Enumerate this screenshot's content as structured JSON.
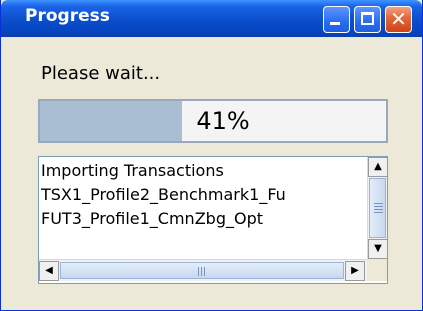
{
  "window": {
    "title": "Progress"
  },
  "title_buttons": {
    "minimize_icon": "minimize-icon",
    "maximize_icon": "maximize-icon",
    "close_icon": "close-icon",
    "close_glyph": "✕"
  },
  "status": {
    "label": "Please wait..."
  },
  "progress": {
    "percent_text": "41%",
    "value": 0.41
  },
  "log": {
    "items": [
      "Importing Transactions",
      "TSX1_Profile2_Benchmark1_Fu",
      "FUT3_Profile1_CmnZbg_Opt"
    ]
  },
  "scrollbars": {
    "up_arrow": "▲",
    "down_arrow": "▼",
    "left_arrow": "◀",
    "right_arrow": "▶"
  },
  "colors": {
    "titlebar": "#0a4ecb",
    "close_button": "#e46a3d",
    "progress_fill": "#a9bdd3",
    "window_bg": "#ece9d8"
  }
}
